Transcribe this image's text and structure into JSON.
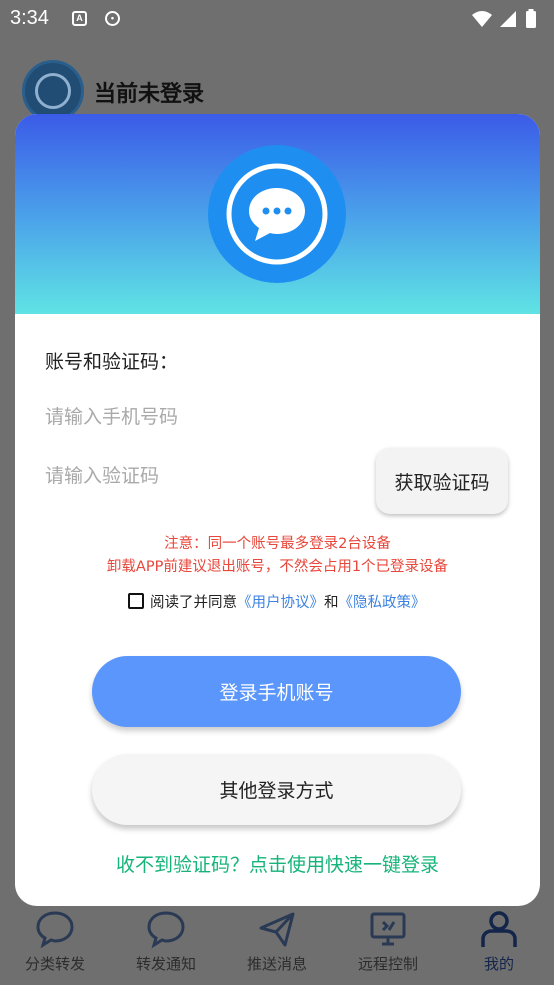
{
  "status_bar": {
    "time": "3:34",
    "icons": [
      "text-a-icon",
      "chat-bubble-icon",
      "wifi-icon",
      "signal-icon",
      "battery-icon"
    ]
  },
  "background": {
    "header_title": "当前未登录",
    "nav": [
      {
        "label": "分类转发",
        "icon": "chat-icon"
      },
      {
        "label": "转发通知",
        "icon": "chat-icon"
      },
      {
        "label": "推送消息",
        "icon": "send-icon"
      },
      {
        "label": "远程控制",
        "icon": "monitor-icon"
      },
      {
        "label": "我的",
        "icon": "person-icon",
        "active": true
      }
    ]
  },
  "dialog": {
    "section_label": "账号和验证码：",
    "phone_placeholder": "请输入手机号码",
    "code_placeholder": "请输入验证码",
    "get_code_label": "获取验证码",
    "notice_line1": "注意：同一个账号最多登录2台设备",
    "notice_line2": "卸载APP前建议退出账号，不然会占用1个已登录设备",
    "agree": {
      "prefix": "阅读了并同意",
      "user_agreement": "《用户协议》",
      "and": "和",
      "privacy_policy": "《隐私政策》",
      "checked": false
    },
    "login_label": "登录手机账号",
    "other_login_label": "其他登录方式",
    "quick_login_link": "收不到验证码？点击使用快速一键登录"
  },
  "colors": {
    "header_gradient_top": "#3b5be8",
    "header_gradient_bottom": "#5fe3e4",
    "primary_button": "#5a96fb",
    "notice": "#e8473b",
    "link": "#3d82e0",
    "quick_link": "#16b47a",
    "logo": "#1e8ff0"
  }
}
